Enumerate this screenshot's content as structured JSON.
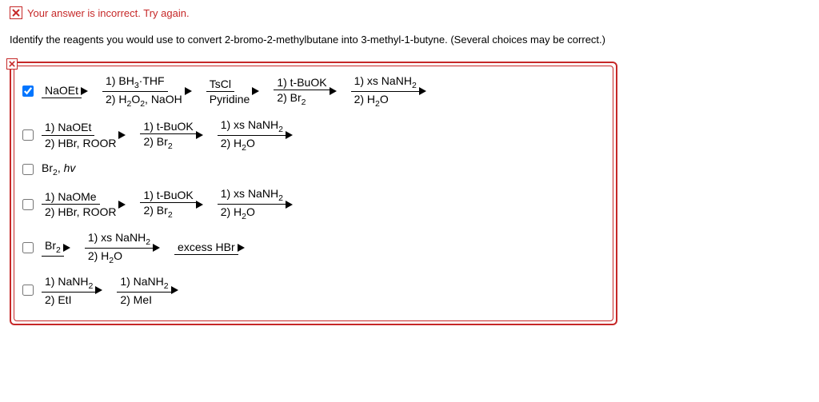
{
  "feedback": "Your answer is incorrect.  Try again.",
  "question": "Identify the reagents you would use to convert 2-bromo-2-methylbutane into 3-methyl-1-butyne. (Several choices may be correct.)",
  "options": [
    {
      "checked": true,
      "reagents": [
        {
          "top": "NaOEt",
          "bottom": ""
        },
        {
          "top": "1) BH<sub>3</sub>·THF",
          "bottom": "2) H<sub>2</sub>O<sub>2</sub>, NaOH"
        },
        {
          "top": "TsCl",
          "bottom": "Pyridine"
        },
        {
          "top": "1) t-BuOK",
          "bottom": "2) Br<sub>2</sub>"
        },
        {
          "top": "1) xs NaNH<sub>2</sub>",
          "bottom": "2) H<sub>2</sub>O"
        }
      ]
    },
    {
      "checked": false,
      "reagents": [
        {
          "top": "1) NaOEt",
          "bottom": "2) HBr, ROOR"
        },
        {
          "top": "1) t-BuOK",
          "bottom": "2) Br<sub>2</sub>"
        },
        {
          "top": "1) xs NaNH<sub>2</sub>",
          "bottom": "2) H<sub>2</sub>O"
        }
      ]
    },
    {
      "checked": false,
      "plain": "Br<sub>2</sub>, <span class=\"italic\">hv</span>"
    },
    {
      "checked": false,
      "reagents": [
        {
          "top": "1) NaOMe",
          "bottom": "2) HBr, ROOR"
        },
        {
          "top": "1) t-BuOK",
          "bottom": "2) Br<sub>2</sub>"
        },
        {
          "top": "1) xs NaNH<sub>2</sub>",
          "bottom": "2) H<sub>2</sub>O"
        }
      ]
    },
    {
      "checked": false,
      "reagents": [
        {
          "top": "Br<sub>2</sub>",
          "bottom": ""
        },
        {
          "top": "1) xs NaNH<sub>2</sub>",
          "bottom": "2) H<sub>2</sub>O"
        },
        {
          "top": "excess HBr",
          "bottom": ""
        }
      ]
    },
    {
      "checked": false,
      "reagents": [
        {
          "top": "1) NaNH<sub>2</sub>",
          "bottom": "2) EtI"
        },
        {
          "top": "1) NaNH<sub>2</sub>",
          "bottom": "2) MeI"
        }
      ]
    }
  ]
}
